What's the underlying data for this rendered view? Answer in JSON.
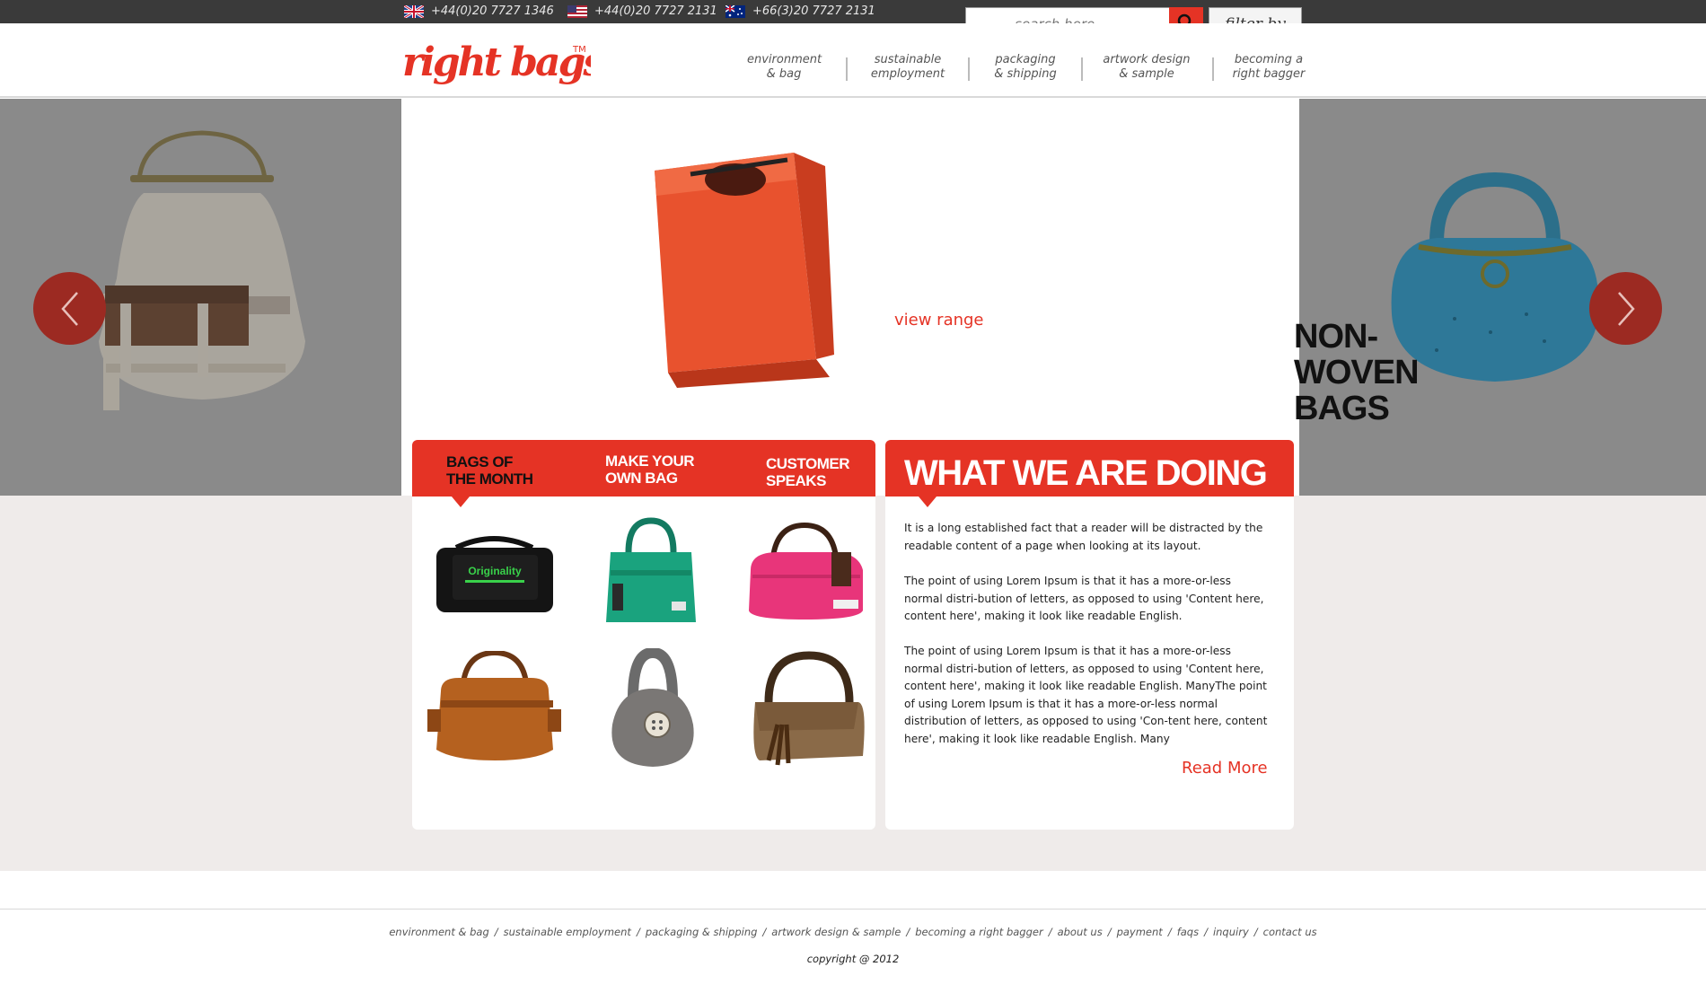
{
  "topbar": {
    "phones": [
      {
        "flag": "uk-flag-icon",
        "number": "+44(0)20 7727 1346"
      },
      {
        "flag": "us-flag-icon",
        "number": "+44(0)20 7727 2131"
      },
      {
        "flag": "au-flag-icon",
        "number": "+66(3)20 7727 2131"
      }
    ],
    "search_placeholder": "search here . . .",
    "search_icon": "search-icon",
    "filter_label": "filter by"
  },
  "brand": {
    "logo_text": "right bags",
    "trademark": "TM",
    "accent_color": "#e53325"
  },
  "nav": [
    {
      "label": "environment\n& bag"
    },
    {
      "label": "sustainable\nemployment"
    },
    {
      "label": "packaging\n& shipping"
    },
    {
      "label": "artwork design\n& sample"
    },
    {
      "label": "becoming a\nright bagger"
    }
  ],
  "hero": {
    "title": "NON-WOVEN\nBAGS",
    "link": "view range",
    "prev_icon": "chevron-left-icon",
    "next_icon": "chevron-right-icon"
  },
  "tabs": [
    {
      "label": "BAGS OF\nTHE MONTH",
      "active": true
    },
    {
      "label": "MAKE YOUR\nOWN BAG",
      "active": false
    },
    {
      "label": "CUSTOMER\nSPEAKS",
      "active": false
    }
  ],
  "bags": [
    {
      "name": "black messenger bag",
      "print": "Originality"
    },
    {
      "name": "green tote bag"
    },
    {
      "name": "pink duffel bag"
    },
    {
      "name": "tan leather satchel"
    },
    {
      "name": "grey felt pouch bag"
    },
    {
      "name": "brown bamboo handle bag"
    }
  ],
  "doing": {
    "title": "WHAT WE ARE DOING",
    "paragraphs": [
      "It is a long established fact that a reader will be distracted by the readable content of a page when looking at its layout.",
      "The point of using Lorem Ipsum is that it has a more-or-less normal distri-bution of letters, as opposed to using 'Content here, content here', making it look like readable English.",
      "The point of using Lorem Ipsum is that it has a more-or-less normal distri-bution of letters, as opposed to using 'Content here, content here', making it look like readable English. ManyThe point of using Lorem Ipsum is that it has a more-or-less normal distribution of letters, as opposed to using 'Con-tent here, content here', making it look like readable English. Many"
    ],
    "read_more": "Read More"
  },
  "footer": {
    "links": [
      "environment & bag",
      "sustainable employment",
      "packaging & shipping",
      "artwork design & sample",
      "becoming a right bagger",
      "about us",
      "payment",
      "faqs",
      "inquiry",
      "contact us"
    ],
    "separator": "/",
    "copyright": "copyright @ 2012"
  }
}
